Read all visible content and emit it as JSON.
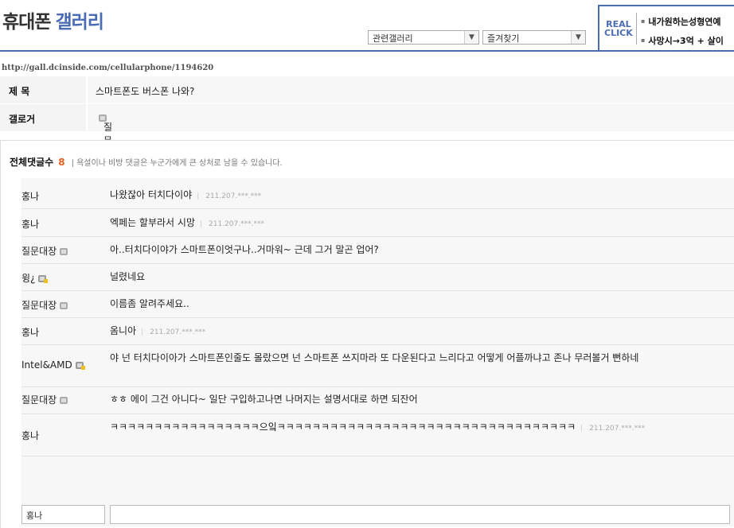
{
  "header": {
    "title_main": "휴대폰",
    "title_accent": "갤러리",
    "related_select": "관련갤러리",
    "favorites_select": "즐겨찾기"
  },
  "ad": {
    "logo_line1": "REAL",
    "logo_line2": "CLICK",
    "line1": "내가원하는성형연예",
    "line2": "사망시→3억 + 살이"
  },
  "url": "http://gall.dcinside.com/cellularphone/1194620",
  "post": {
    "subject_label": "제 목",
    "subject": "스마트폰도 버스폰 나와?",
    "author_label": "갤로거",
    "author": "질문대장"
  },
  "comments": {
    "label": "전체댓글수",
    "count": "8",
    "notice": "| 욕설이나 비방 댓글은 누군가에게 큰 상처로 남을 수 있습니다.",
    "items": [
      {
        "name": "홍나",
        "text": "나왔잖아 터치다이야",
        "ip": "211.207.***.***"
      },
      {
        "name": "홍나",
        "text": "엑페는 할부라서 시망",
        "ip": "211.207.***.***"
      },
      {
        "name": "질문대장",
        "text": "아..터치다이야가 스마트폰이엇구나..거마워~ 근데 그거 말곤 업어?",
        "ip": ""
      },
      {
        "name": "윙¿",
        "text": "널렸네요",
        "ip": ""
      },
      {
        "name": "질문대장",
        "text": "이름좀 알려주세요..",
        "ip": ""
      },
      {
        "name": "홍나",
        "text": "옴니아",
        "ip": "211.207.***.***"
      },
      {
        "name": "Intel&AMD",
        "text": "야 넌 터치다이아가 스마트폰인줄도 몰랐으면 넌 스마트폰 쓰지마라 또 다운된다고 느리다고 어떻게 어플까냐고 존나 무러볼거 뻔하네",
        "ip": ""
      },
      {
        "name": "질문대장",
        "text": "ㅎㅎ 에이 그건 아니다~ 일단 구입하고나면 나머지는 설명서대로 하면 되잔어",
        "ip": ""
      },
      {
        "name": "홍나",
        "text": "ㅋㅋㅋㅋㅋㅋㅋㅋㅋㅋㅋㅋㅋㅋㅋㅋㅋ으잌ㅋㅋㅋㅋㅋㅋㅋㅋㅋㅋㅋㅋㅋㅋㅋㅋㅋㅋㅋㅋㅋㅋㅋㅋㅋㅋㅋㅋㅋㅋㅋㅋㅋㅋ",
        "ip": "211.207.***.***"
      }
    ],
    "name_input_value": "홍나"
  }
}
